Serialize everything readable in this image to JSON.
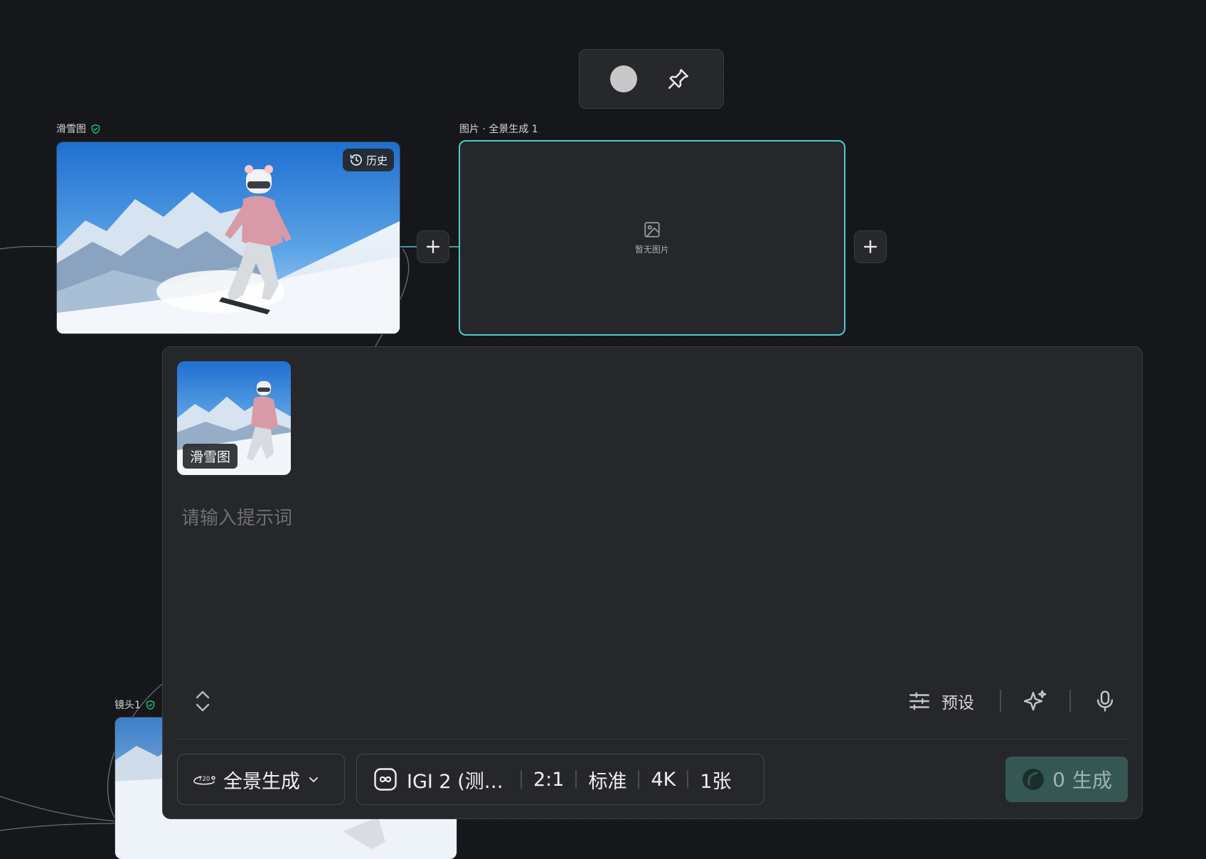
{
  "canvas": {
    "nodes": {
      "ski_image": {
        "title": "滑雪图",
        "history_label": "历史"
      },
      "panorama": {
        "title": "图片 · 全景生成 1",
        "empty_text": "暂无图片"
      },
      "shot1": {
        "title": "镜头1"
      }
    }
  },
  "prompt_panel": {
    "reference": {
      "tag": "滑雪图"
    },
    "prompt": {
      "value": "",
      "placeholder": "请输入提示词"
    },
    "tools": {
      "preset_label": "预设"
    },
    "mode": {
      "label": "全景生成"
    },
    "settings": {
      "model": "IGI 2 (测…",
      "ratio": "2:1",
      "quality": "标准",
      "resolution": "4K",
      "count": "1张"
    },
    "generate": {
      "count": "0",
      "label": "生成"
    }
  },
  "colors": {
    "accent_selected": "#4fc9cd",
    "verified": "#2dbf6a",
    "generate_bg": "#345753"
  },
  "icons": [
    "color-dot",
    "pin-icon",
    "shield-check-icon",
    "history-icon",
    "image-placeholder-icon",
    "plus-icon",
    "expand-icon",
    "sliders-icon",
    "sparkle-icon",
    "microphone-icon",
    "panorama-720-icon",
    "chevron-down-icon",
    "model-logo-icon",
    "bean-icon"
  ]
}
